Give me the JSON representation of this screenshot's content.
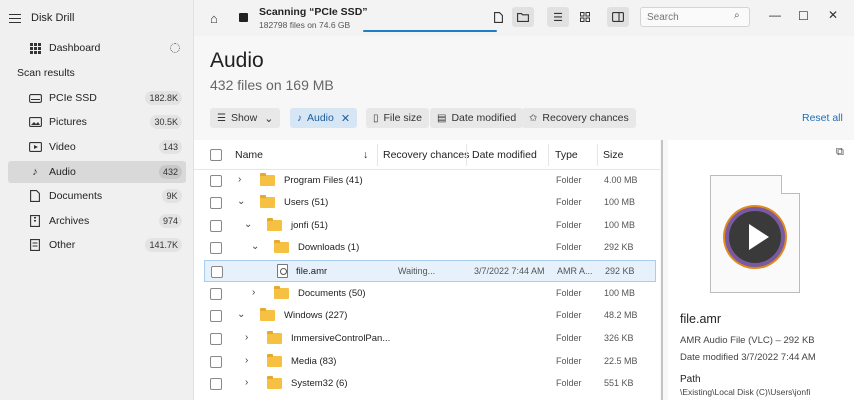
{
  "app": {
    "title": "Disk Drill"
  },
  "sidebar": {
    "dashboard": "Dashboard",
    "section": "Scan results",
    "items": [
      {
        "label": "PCIe SSD",
        "count": "182.8K",
        "icon": "drive-icon"
      },
      {
        "label": "Pictures",
        "count": "30.5K",
        "icon": "picture-icon"
      },
      {
        "label": "Video",
        "count": "143",
        "icon": "video-icon"
      },
      {
        "label": "Audio",
        "count": "432",
        "icon": "music-note-icon",
        "active": true
      },
      {
        "label": "Documents",
        "count": "9K",
        "icon": "document-icon"
      },
      {
        "label": "Archives",
        "count": "974",
        "icon": "archive-icon"
      },
      {
        "label": "Other",
        "count": "141.7K",
        "icon": "other-file-icon"
      }
    ]
  },
  "topbar": {
    "scan_title": "Scanning “PCIe SSD”",
    "scan_sub": "182798 files on 74.6 GB",
    "search_placeholder": "Search"
  },
  "main": {
    "title": "Audio",
    "subtitle": "432 files on 169 MB",
    "filters": {
      "show": "Show",
      "audio": "Audio",
      "file_size": "File size",
      "date_modified": "Date modified",
      "recovery_chances": "Recovery chances"
    },
    "reset_all": "Reset all"
  },
  "table": {
    "columns": {
      "name": "Name",
      "recovery": "Recovery chances",
      "date": "Date modified",
      "type": "Type",
      "size": "Size"
    },
    "rows": [
      {
        "name": "Program Files (41)",
        "recovery": "",
        "date": "",
        "type": "Folder",
        "size": "4.00 MB"
      },
      {
        "name": "Users (51)",
        "recovery": "",
        "date": "",
        "type": "Folder",
        "size": "100 MB"
      },
      {
        "name": "jonfi (51)",
        "recovery": "",
        "date": "",
        "type": "Folder",
        "size": "100 MB"
      },
      {
        "name": "Downloads (1)",
        "recovery": "",
        "date": "",
        "type": "Folder",
        "size": "292 KB"
      },
      {
        "name": "file.amr",
        "recovery": "Waiting...",
        "date": "3/7/2022 7:44 AM",
        "type": "AMR A...",
        "size": "292 KB"
      },
      {
        "name": "Documents (50)",
        "recovery": "",
        "date": "",
        "type": "Folder",
        "size": "100 MB"
      },
      {
        "name": "Windows (227)",
        "recovery": "",
        "date": "",
        "type": "Folder",
        "size": "48.2 MB"
      },
      {
        "name": "ImmersiveControlPan...",
        "recovery": "",
        "date": "",
        "type": "Folder",
        "size": "326 KB"
      },
      {
        "name": "Media (83)",
        "recovery": "",
        "date": "",
        "type": "Folder",
        "size": "22.5 MB"
      },
      {
        "name": "System32 (6)",
        "recovery": "",
        "date": "",
        "type": "Folder",
        "size": "551 KB"
      }
    ]
  },
  "details": {
    "name": "file.amr",
    "type_line": "AMR Audio File (VLC) – 292 KB",
    "date_line": "Date modified 3/7/2022 7:44 AM",
    "path_label": "Path",
    "path_value": "\\Existing\\Local Disk (C)\\Users\\jonfi"
  }
}
